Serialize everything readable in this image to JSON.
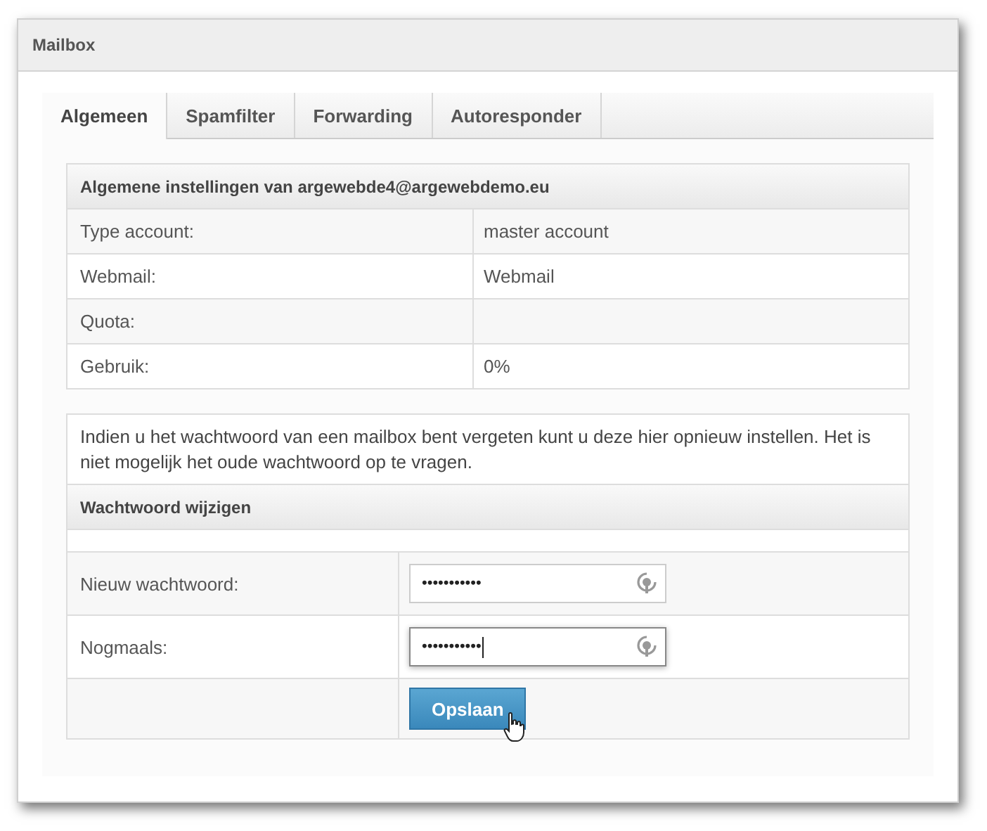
{
  "window": {
    "title": "Mailbox"
  },
  "tabs": [
    {
      "label": "Algemeen",
      "selected": true
    },
    {
      "label": "Spamfilter",
      "selected": false
    },
    {
      "label": "Forwarding",
      "selected": false
    },
    {
      "label": "Autoresponder",
      "selected": false
    }
  ],
  "settings": {
    "title": "Algemene instellingen van argewebde4@argewebdemo.eu",
    "rows": [
      {
        "label": "Type account:",
        "value": "master account"
      },
      {
        "label": "Webmail:",
        "value": "Webmail"
      },
      {
        "label": "Quota:"
      },
      {
        "label": "Gebruik:",
        "value": "0%"
      }
    ]
  },
  "password": {
    "note": "Indien u het wachtwoord van een mailbox bent vergeten kunt u deze hier opnieuw instellen. Het is niet mogelijk het oude wachtwoord op te vragen.",
    "title": "Wachtwoord wijzigen",
    "fields": [
      {
        "label": "Nieuw wachtwoord:",
        "value": "•••••••••••",
        "focused": false
      },
      {
        "label": "Nogmaals:",
        "value": "•••••••••••",
        "focused": true
      }
    ],
    "button": "Opslaan"
  }
}
